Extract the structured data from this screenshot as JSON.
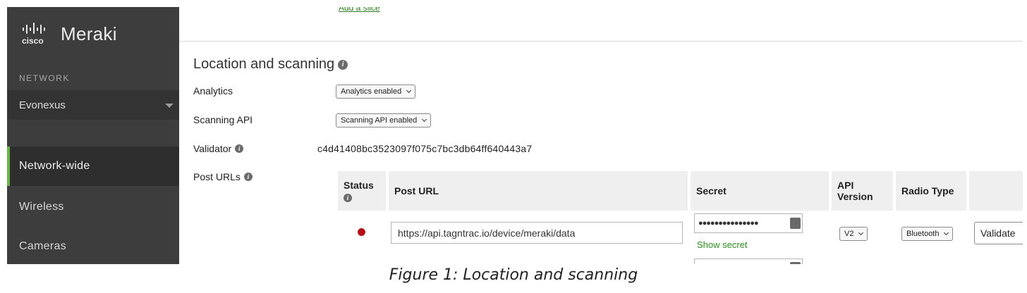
{
  "brand": {
    "logo_text": "cisco",
    "name": "Meraki"
  },
  "sidebar": {
    "section_label": "NETWORK",
    "network_selected": "Evonexus",
    "items": [
      {
        "label": "Network-wide",
        "active": true
      },
      {
        "label": "Wireless",
        "active": false
      },
      {
        "label": "Cameras",
        "active": false
      }
    ]
  },
  "main": {
    "add_slice_link": "Add a slice",
    "section_title": "Location and scanning",
    "analytics": {
      "label": "Analytics",
      "value": "Analytics enabled"
    },
    "scanning_api": {
      "label": "Scanning API",
      "value": "Scanning API enabled"
    },
    "validator": {
      "label": "Validator",
      "value": "c4d41408bc3523097f075c7bc3db64ff640443a7"
    },
    "post_urls": {
      "label": "Post URLs",
      "columns": {
        "status": "Status",
        "post_url": "Post URL",
        "secret": "Secret",
        "api_version_line1": "API",
        "api_version_line2": "Version",
        "radio_type": "Radio Type"
      },
      "rows": [
        {
          "status_color": "#b3101a",
          "post_url": "https://api.tagntrac.io/device/meraki/data",
          "secret_masked": "●●●●●●●●●●●●●●●",
          "show_secret": "Show secret",
          "api_version": "V2",
          "radio_type": "Bluetooth",
          "validate": "Validate"
        }
      ]
    }
  },
  "caption": "Figure 1: Location and scanning",
  "colors": {
    "sidebar_bg": "#3d3d3d",
    "active_accent": "#67b346",
    "link_green": "#2e8b1e",
    "status_red": "#b3101a"
  }
}
